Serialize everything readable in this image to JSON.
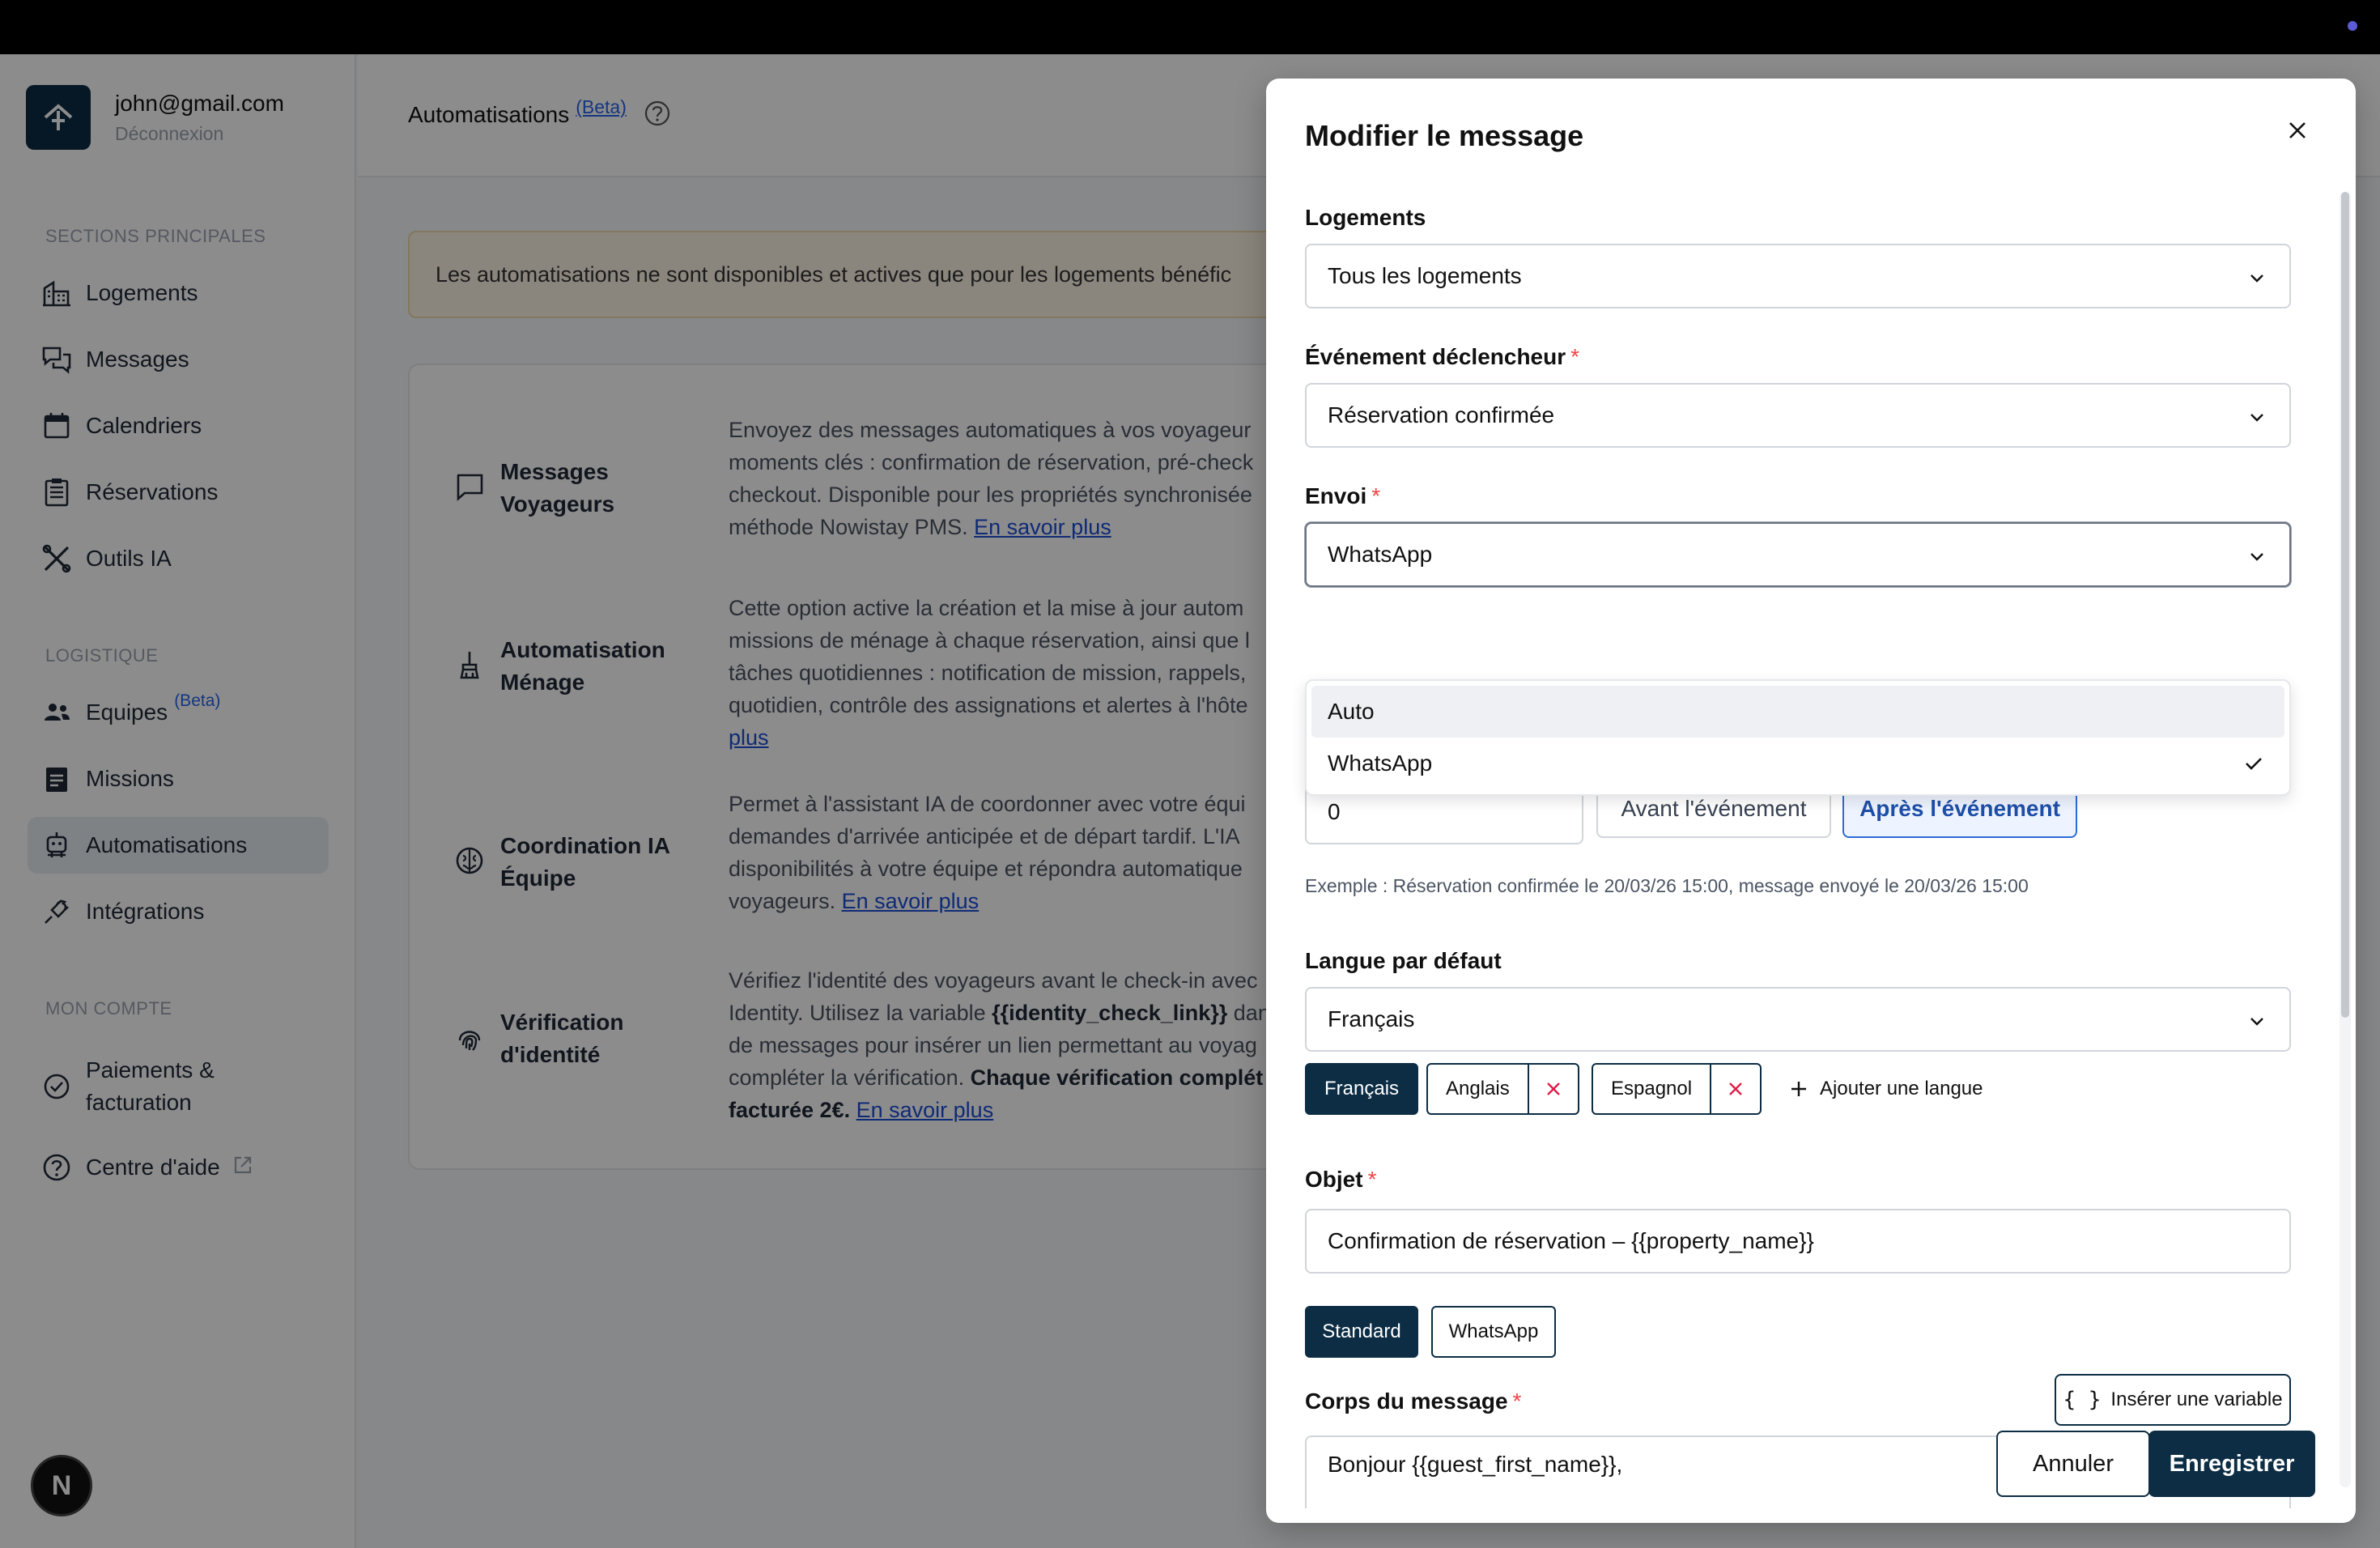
{
  "user": {
    "email": "john@gmail.com",
    "logout": "Déconnexion"
  },
  "sidebar": {
    "sections": [
      {
        "title": "SECTIONS PRINCIPALES",
        "items": [
          "Logements",
          "Messages",
          "Calendriers",
          "Réservations",
          "Outils IA"
        ]
      },
      {
        "title": "LOGISTIQUE",
        "items": [
          "Equipes",
          "Missions",
          "Automatisations",
          "Intégrations"
        ]
      },
      {
        "title": "MON COMPTE",
        "items": [
          "Paiements &",
          "facturation",
          "Centre d'aide"
        ]
      }
    ],
    "equipes_beta": "(Beta)",
    "active": "Automatisations",
    "badge": "N"
  },
  "main": {
    "title": "Automatisations",
    "beta": "(Beta)",
    "banner": "Les automatisations ne sont disponibles et actives que pour les logements bénéfic",
    "features": [
      {
        "name_1": "Messages",
        "name_2": "Voyageurs",
        "lines": [
          "Envoyez des messages automatiques à vos voyageur",
          "moments clés : confirmation de réservation, pré-check",
          "checkout. Disponible pour les propriétés synchronisée",
          "méthode Nowistay PMS. "
        ],
        "link": "En savoir plus"
      },
      {
        "name_1": "Automatisation",
        "name_2": "Ménage",
        "lines": [
          "Cette option active la création et la mise à jour autom",
          "missions de ménage à chaque réservation, ainsi que l",
          "tâches quotidiennes : notification de mission, rappels,",
          "quotidien, contrôle des assignations et alertes à l'hôte"
        ],
        "link": "plus"
      },
      {
        "name_1": "Coordination IA",
        "name_2": "Équipe",
        "lines": [
          "Permet à l'assistant IA de coordonner avec votre équi",
          "demandes d'arrivée anticipée et de départ tardif. L'IA",
          "disponibilités à votre équipe et répondra automatique",
          "voyageurs. "
        ],
        "link": "En savoir plus"
      },
      {
        "name_1": "Vérification",
        "name_2": "d'identité",
        "line1": "Vérifiez l'identité des voyageurs avant le check-in avec",
        "line2_a": "Identity. Utilisez la variable ",
        "line2_b": "{{identity_check_link}}",
        "line2_c": " dan",
        "line3": "de messages pour insérer un lien permettant au voyag",
        "line4_a": "compléter la vérification. ",
        "line4_b": "Chaque vérification complét",
        "line5_a": "facturée 2€.",
        "line5_b": " ",
        "link": "En savoir plus"
      }
    ]
  },
  "modal": {
    "title": "Modifier le message",
    "logements": {
      "label": "Logements",
      "value": "Tous les logements"
    },
    "event": {
      "label": "Événement déclencheur",
      "required": "*",
      "value": "Réservation confirmée"
    },
    "envoi": {
      "label": "Envoi",
      "required": "*",
      "value": "WhatsApp",
      "options": [
        "Auto",
        "WhatsApp"
      ]
    },
    "timing": {
      "value": "0",
      "before": "Avant l'événement",
      "after": "Après l'événement"
    },
    "example": "Exemple : Réservation confirmée le 20/03/26 15:00, message envoyé le 20/03/26 15:00",
    "langue": {
      "label": "Langue par défaut",
      "value": "Français"
    },
    "languages": [
      "Français",
      "Anglais",
      "Espagnol"
    ],
    "add_language": "Ajouter une langue",
    "objet": {
      "label": "Objet",
      "required": "*",
      "value": "Confirmation de réservation – {{property_name}}"
    },
    "format_tabs": [
      "Standard",
      "WhatsApp"
    ],
    "body": {
      "label": "Corps du message",
      "required": "*",
      "insert": "Insérer une variable",
      "value": "Bonjour {{guest_first_name}},"
    },
    "cancel": "Annuler",
    "save": "Enregistrer"
  }
}
